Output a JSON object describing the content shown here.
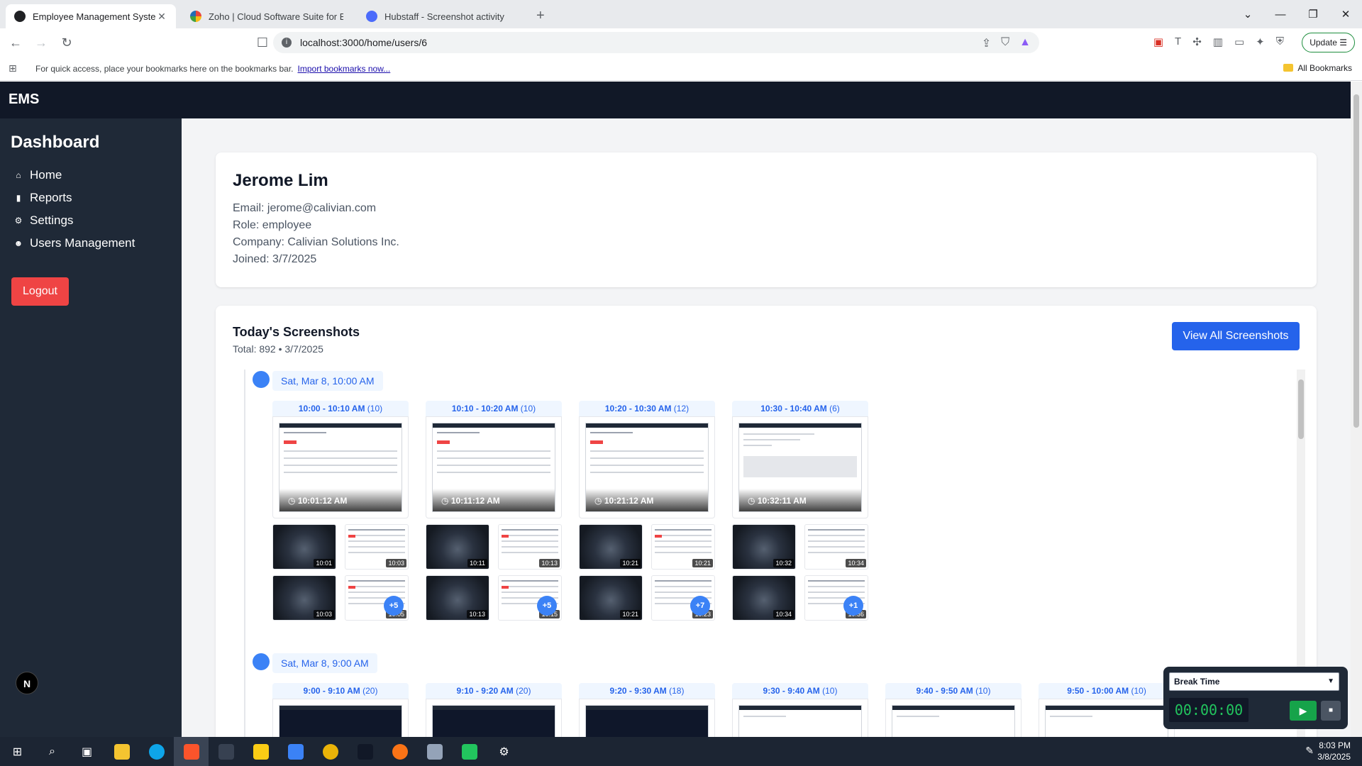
{
  "browser": {
    "tabs": [
      {
        "title": "Employee Management System",
        "active": true,
        "color": "#202124"
      },
      {
        "title": "Zoho | Cloud Software Suite for Bus",
        "active": false,
        "color": "#e8453c"
      },
      {
        "title": "Hubstaff - Screenshot activity",
        "active": false,
        "color": "#4b6bfb"
      }
    ],
    "url": "localhost:3000/home/users/6",
    "update_label": "Update",
    "bookmarks_hint": "For quick access, place your bookmarks here on the bookmarks bar.",
    "bookmarks_link": "Import bookmarks now...",
    "all_bookmarks": "All Bookmarks"
  },
  "app": {
    "brand": "EMS",
    "sidebar": {
      "title": "Dashboard",
      "items": [
        {
          "label": "Home",
          "icon": "home-icon"
        },
        {
          "label": "Reports",
          "icon": "chart-icon"
        },
        {
          "label": "Settings",
          "icon": "gear-icon"
        },
        {
          "label": "Users Management",
          "icon": "users-icon"
        }
      ],
      "logout_label": "Logout",
      "badge": "N"
    },
    "profile": {
      "name": "Jerome Lim",
      "email": "Email: jerome@calivian.com",
      "role": "Role: employee",
      "company": "Company: Calivian Solutions Inc.",
      "joined": "Joined: 3/7/2025"
    },
    "screenshots": {
      "title": "Today's Screenshots",
      "subtitle": "Total: 892 • 3/7/2025",
      "view_all_label": "View All Screenshots",
      "groups": [
        {
          "hour_label": "Sat, Mar 8, 10:00 AM",
          "segments": [
            {
              "range": "10:00 - 10:10 AM",
              "count": "(10)",
              "time": "10:01:12 AM",
              "minis": [
                "10:01",
                "10:03",
                "10:03",
                "10:05"
              ],
              "more": "+5"
            },
            {
              "range": "10:10 - 10:20 AM",
              "count": "(10)",
              "time": "10:11:12 AM",
              "minis": [
                "10:11",
                "10:13",
                "10:13",
                "10:15"
              ],
              "more": "+5"
            },
            {
              "range": "10:20 - 10:30 AM",
              "count": "(12)",
              "time": "10:21:12 AM",
              "minis": [
                "10:21",
                "10:21",
                "10:21",
                "10:23"
              ],
              "more": "+7"
            },
            {
              "range": "10:30 - 10:40 AM",
              "count": "(6)",
              "time": "10:32:11 AM",
              "minis": [
                "10:32",
                "10:34",
                "10:34",
                "10:36"
              ],
              "more": "+1"
            }
          ]
        },
        {
          "hour_label": "Sat, Mar 8, 9:00 AM",
          "segments": [
            {
              "range": "9:00 - 9:10 AM",
              "count": "(20)"
            },
            {
              "range": "9:10 - 9:20 AM",
              "count": "(20)"
            },
            {
              "range": "9:20 - 9:30 AM",
              "count": "(18)"
            },
            {
              "range": "9:30 - 9:40 AM",
              "count": "(10)"
            },
            {
              "range": "9:40 - 9:50 AM",
              "count": "(10)"
            },
            {
              "range": "9:50 - 10:00 AM",
              "count": "(10)"
            }
          ]
        }
      ]
    },
    "timer": {
      "mode": "Break Time",
      "display": "00:00:00"
    }
  },
  "taskbar": {
    "time": "8:03 PM",
    "date": "3/8/2025"
  }
}
